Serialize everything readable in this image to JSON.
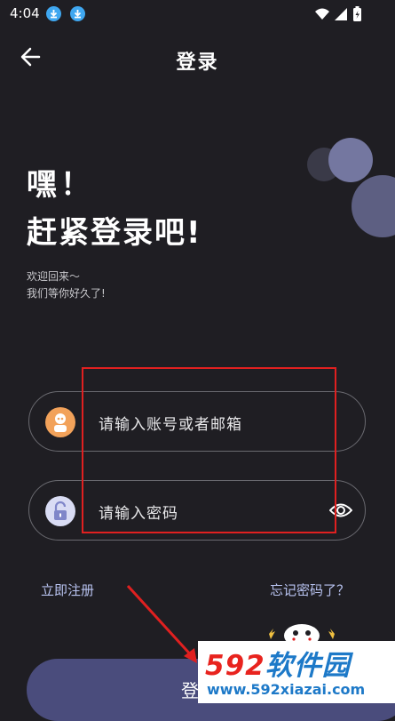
{
  "status_bar": {
    "time": "4:04"
  },
  "header": {
    "title": "登录"
  },
  "greeting": {
    "line1": "嘿！",
    "line2": "赶紧登录吧!",
    "sub1": "欢迎回来～",
    "sub2": "我们等你好久了!"
  },
  "form": {
    "account_placeholder": "请输入账号或者邮箱",
    "password_placeholder": "请输入密码"
  },
  "links": {
    "register": "立即注册",
    "forgot": "忘记密码了？"
  },
  "login_button": {
    "label": "登录"
  },
  "watermark": {
    "brand_num": "592",
    "brand_text": "软件园",
    "url": "www.592xiazai.com"
  },
  "colors": {
    "background": "#1f1e23",
    "accent": "#4a4c7c",
    "link": "#b8c3f0",
    "annotation": "#e02020"
  }
}
